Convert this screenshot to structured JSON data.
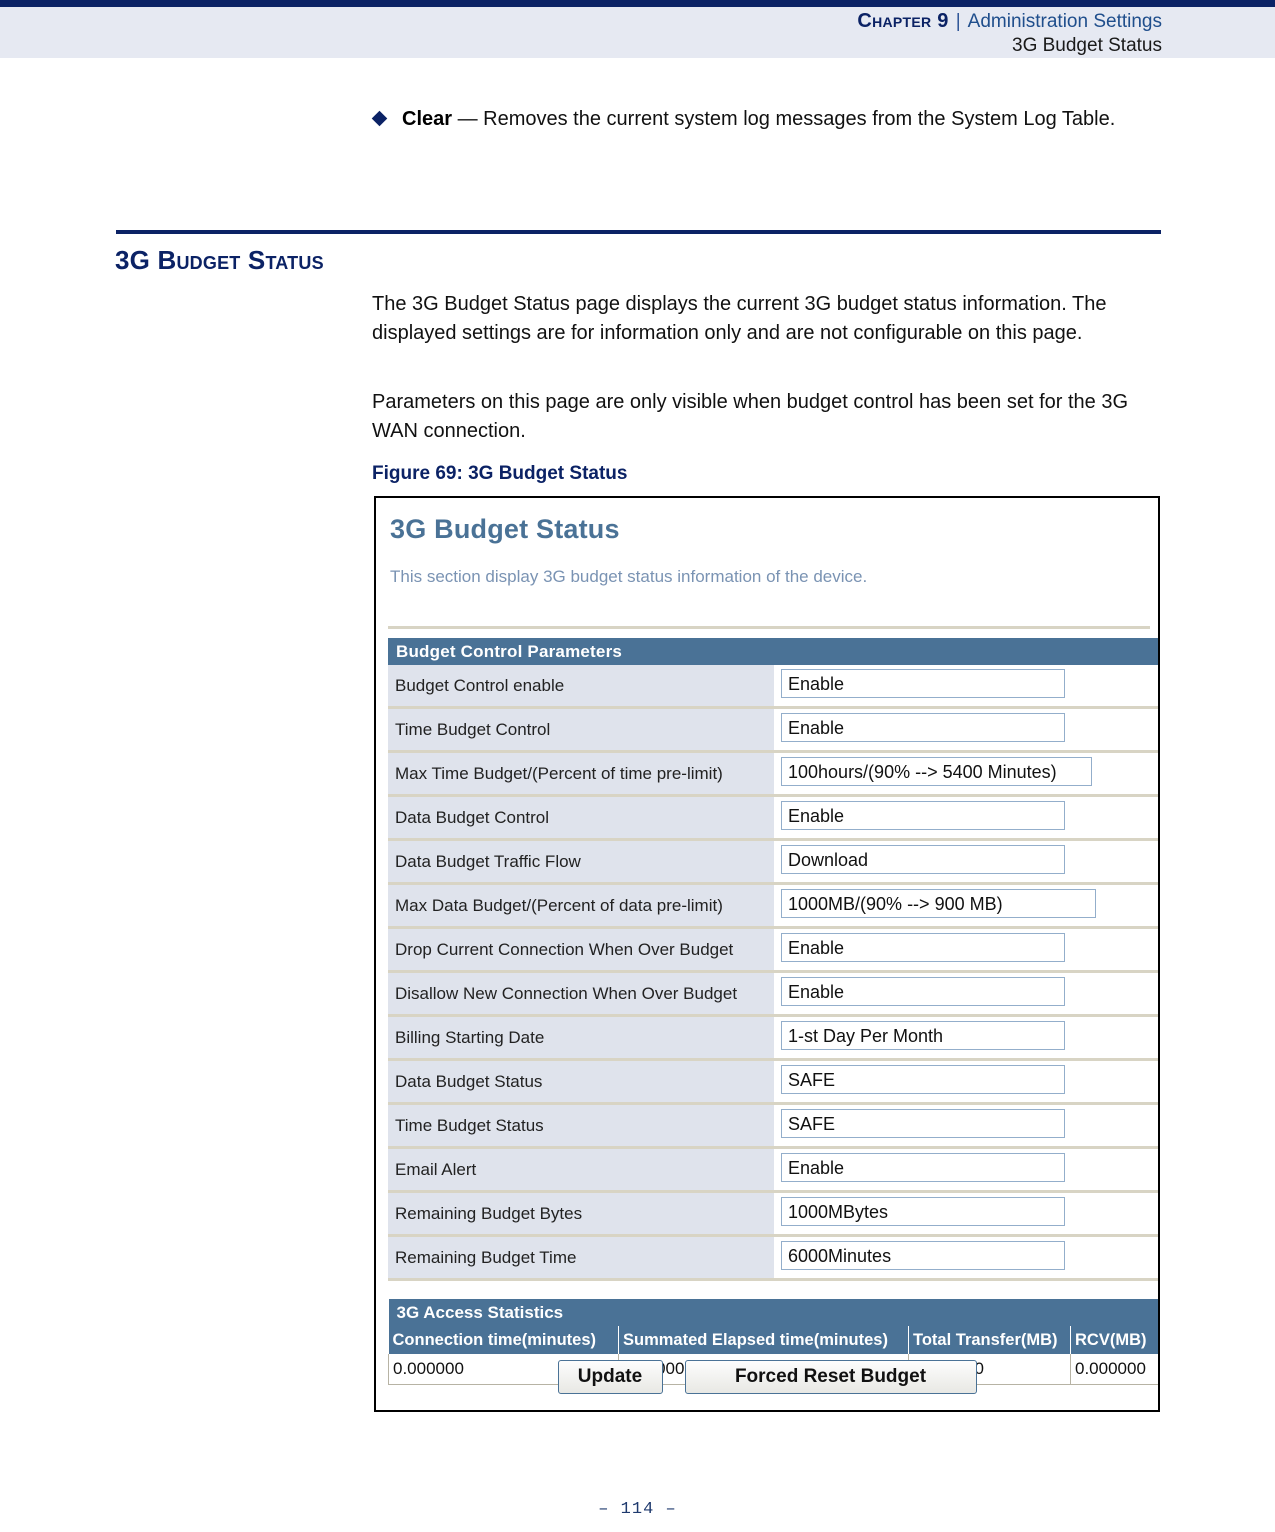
{
  "page_header": {
    "chapter": "Chapter 9",
    "separator": "|",
    "section": "Administration Settings",
    "subsection": "3G Budget Status"
  },
  "bullet": {
    "term": "Clear",
    "description": " — Removes the current system log messages from the System Log Table."
  },
  "section": {
    "heading": "3G Budget Status",
    "paragraph_1": "The 3G Budget Status page displays the current 3G budget status information. The displayed settings are for information only and are not configurable on this page.",
    "paragraph_2": "Parameters on this page are only visible when budget control has been set for the 3G WAN connection.",
    "figure_caption": "Figure 69:  3G Budget Status"
  },
  "figure": {
    "ui_title": "3G Budget Status",
    "ui_subtitle": "This section display 3G budget status information of the device.",
    "budget_section_title": "Budget Control Parameters",
    "rows": [
      {
        "label": "Budget Control enable",
        "value": "Enable"
      },
      {
        "label": "Time Budget Control",
        "value": "Enable"
      },
      {
        "label": "Max Time Budget/(Percent of time pre-limit)",
        "value": "100hours/(90% --> 5400 Minutes)"
      },
      {
        "label": "Data Budget Control",
        "value": "Enable"
      },
      {
        "label": "Data Budget Traffic Flow",
        "value": "Download"
      },
      {
        "label": "Max Data Budget/(Percent of data pre-limit)",
        "value": "1000MB/(90% --> 900 MB)"
      },
      {
        "label": "Drop Current Connection When Over Budget",
        "value": "Enable"
      },
      {
        "label": "Disallow New Connection When Over Budget",
        "value": "Enable"
      },
      {
        "label": "Billing Starting Date",
        "value": "1-st Day Per Month"
      },
      {
        "label": "Data Budget Status",
        "value": "SAFE"
      },
      {
        "label": "Time Budget Status",
        "value": "SAFE"
      },
      {
        "label": "Email Alert",
        "value": "Enable"
      },
      {
        "label": "Remaining Budget Bytes",
        "value": "1000MBytes"
      },
      {
        "label": "Remaining Budget Time",
        "value": "6000Minutes"
      }
    ],
    "stats_section_title": "3G Access Statistics",
    "stats_headers": [
      "Connection time(minutes)",
      "Summated Elapsed time(minutes)",
      "Total Transfer(MB)",
      "RCV(MB)"
    ],
    "stats_values": [
      "0.000000",
      "0.000000",
      "0.000000",
      "0.000000"
    ],
    "buttons": {
      "update": "Update",
      "forced_reset": "Forced Reset Budget"
    }
  },
  "footer": {
    "page_number": "–  114  –"
  },
  "colors": {
    "navy": "#0b2265",
    "header_band": "#e6e9f2",
    "steel_blue": "#4a7296",
    "label_cell": "#dfe3ec",
    "row_divider": "#d8d4c4",
    "input_border": "#93aecb",
    "subtitle_blue": "#7a93b3"
  }
}
